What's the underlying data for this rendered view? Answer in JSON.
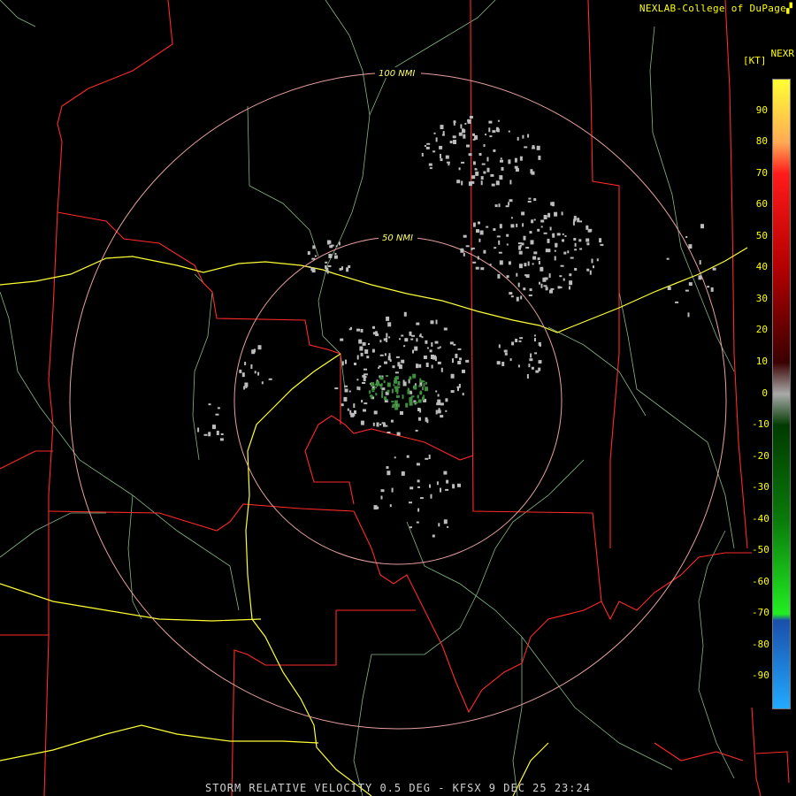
{
  "header": {
    "source": "NEXLAB-College of DuPage",
    "product_abbr": "NEXR",
    "unit": "[KT]"
  },
  "footer": {
    "caption": "STORM RELATIVE VELOCITY 0.5 DEG - KFSX 9 DEC 25 23:24"
  },
  "range_rings": [
    {
      "label": "50 NMI",
      "radius_nmi": 50
    },
    {
      "label": "100 NMI",
      "radius_nmi": 100
    }
  ],
  "velocity_scale": {
    "ticks": [
      "90",
      "80",
      "70",
      "60",
      "50",
      "40",
      "30",
      "20",
      "10",
      "0",
      "-10",
      "-20",
      "-30",
      "-40",
      "-50",
      "-60",
      "-70",
      "-80",
      "-90"
    ],
    "stops": [
      {
        "value": 100,
        "color": "#ffff33"
      },
      {
        "value": 80,
        "color": "#ffaa55"
      },
      {
        "value": 70,
        "color": "#ff1a1a"
      },
      {
        "value": 40,
        "color": "#b30000"
      },
      {
        "value": 10,
        "color": "#3a0000"
      },
      {
        "value": 0,
        "color": "#aaaaaa"
      },
      {
        "value": -10,
        "color": "#003a00"
      },
      {
        "value": -40,
        "color": "#0a7a0a"
      },
      {
        "value": -70,
        "color": "#22ee22"
      },
      {
        "value": -72,
        "color": "#1a4faa"
      },
      {
        "value": -100,
        "color": "#22aaff"
      }
    ]
  },
  "colors": {
    "range_ring": "#e8a0a0",
    "state_border": "#ff2a2a",
    "highway": "#ffff33",
    "county_line": "#9fd79f",
    "echo_gray": "#bdbdbd",
    "echo_green": "#3f8f3f"
  }
}
